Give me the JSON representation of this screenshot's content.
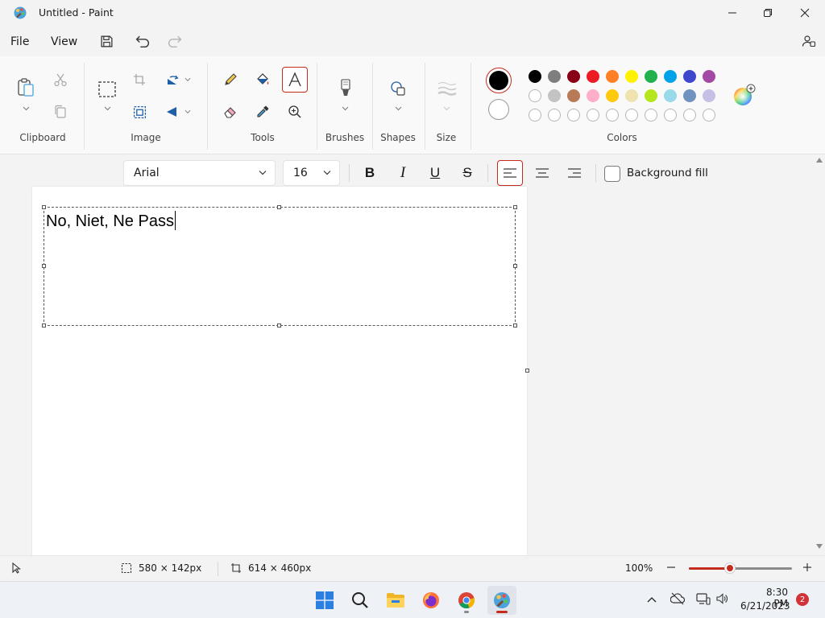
{
  "window": {
    "title": "Untitled - Paint"
  },
  "menu": {
    "file": "File",
    "view": "View"
  },
  "ribbon": {
    "groups": {
      "clipboard": "Clipboard",
      "image": "Image",
      "tools": "Tools",
      "brushes": "Brushes",
      "shapes": "Shapes",
      "size": "Size",
      "colors": "Colors"
    },
    "primary_color": "#000000",
    "secondary_color": "#ffffff",
    "palette_row1": [
      "#000000",
      "#7f7f7f",
      "#880015",
      "#ed1c24",
      "#ff7f27",
      "#fff200",
      "#22b14c",
      "#00a2e8",
      "#3f48cc",
      "#a349a4"
    ],
    "palette_row2": [
      "#ffffff",
      "#c3c3c3",
      "#b97a57",
      "#ffaec9",
      "#ffc90e",
      "#efe4b0",
      "#b5e61d",
      "#99d9ea",
      "#7092be",
      "#c8bfe7"
    ]
  },
  "text_toolbar": {
    "font_family": "Arial",
    "font_size": "16",
    "bold_glyph": "B",
    "italic_glyph": "I",
    "underline_glyph": "U",
    "strike_glyph": "S",
    "background_fill": "Background fill"
  },
  "canvas": {
    "text": "No, Niet, Ne Pass"
  },
  "status": {
    "selection_size": "580 × 142px",
    "canvas_size": "614 × 460px",
    "zoom": "100%",
    "zoom_level": 0.4
  },
  "taskbar": {
    "time": "8:30 PM",
    "date": "6/21/2023",
    "notifications": "2"
  },
  "accent": "#c42b1c"
}
